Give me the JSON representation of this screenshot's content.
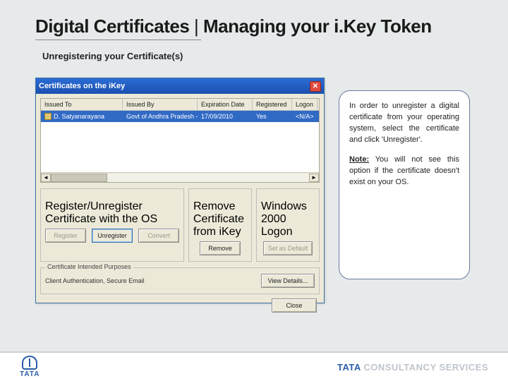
{
  "slide": {
    "title_strong": "Digital Certificates",
    "title_sep": " | ",
    "title_rest": "Managing your i.Key Token",
    "subtitle": "Unregistering your Certificate(s)"
  },
  "window": {
    "title": "Certificates on the iKey",
    "close_glyph": "✕",
    "columns": {
      "issued_to": "Issued To",
      "issued_by": "Issued By",
      "expiration": "Expiration Date",
      "registered": "Registered",
      "logon": "Logon"
    },
    "row": {
      "issued_to": "D. Satyanarayana",
      "issued_by": "Govt of Andhra Pradesh - II",
      "expiration": "17/09/2010",
      "registered": "Yes",
      "logon": "<N/A>"
    },
    "groups": {
      "register_legend": "Register/Unregister Certificate with the OS",
      "remove_legend": "Remove Certificate from iKey",
      "logon_legend": "Windows 2000 Logon"
    },
    "buttons": {
      "register": "Register",
      "unregister": "Unregister",
      "convert": "Convert",
      "remove": "Remove",
      "set_default": "Set as Default",
      "view_details": "View Details...",
      "close": "Close"
    },
    "intended": {
      "legend": "Certificate Intended Purposes",
      "text": "Client Authentication, Secure Email"
    },
    "scroll": {
      "left": "◄",
      "right": "►"
    }
  },
  "callout": {
    "p1": "In order to unregister a digital certificate from your operating system, select the certificate and click 'Unregister'.",
    "note_label": "Note:",
    "p2": " You will not see this option if the certificate doesn't exist on your OS."
  },
  "footer": {
    "tata": "TATA",
    "tcs_blue": "TATA",
    "tcs_light": " CONSULTANCY SERVICES"
  }
}
